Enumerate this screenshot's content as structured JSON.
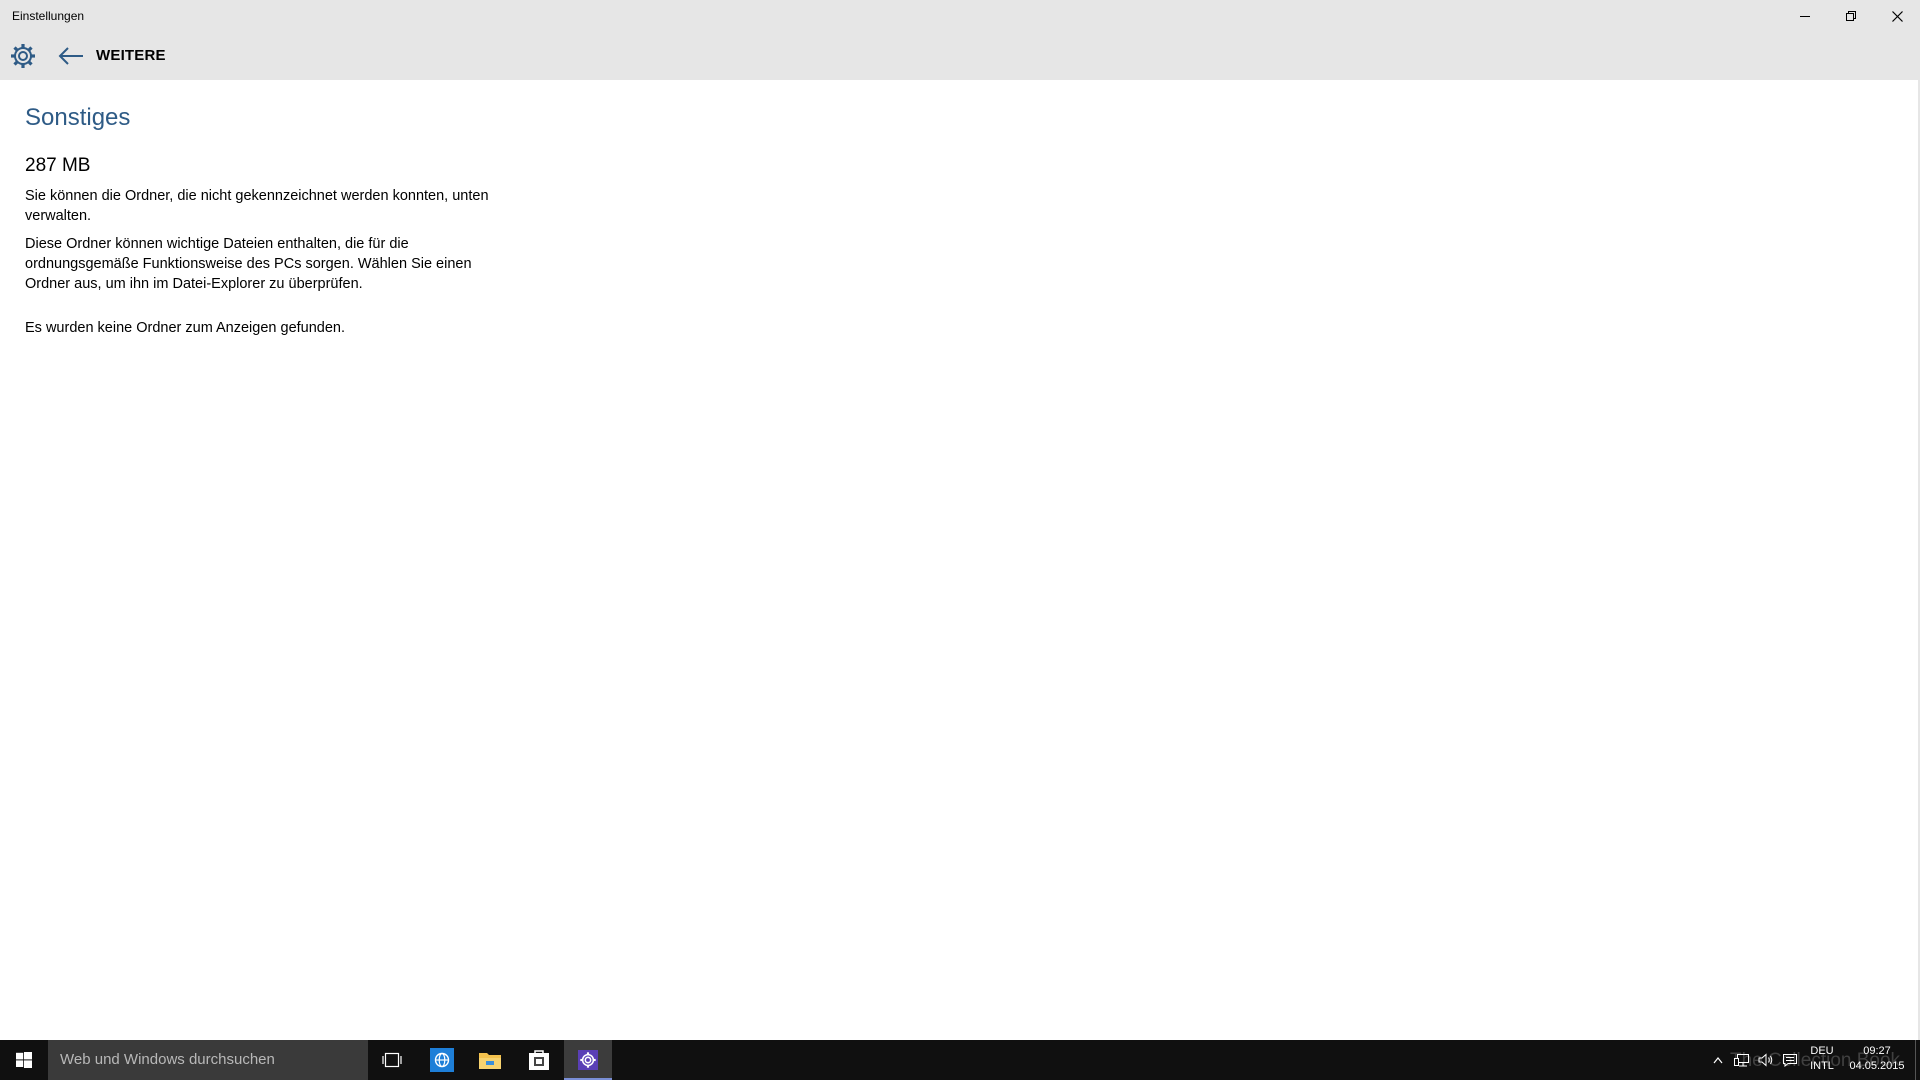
{
  "window": {
    "title": "Einstellungen"
  },
  "header": {
    "section_title": "WEITERE"
  },
  "main": {
    "page_title": "Sonstiges",
    "size": "287 MB",
    "paragraph1": "Sie können die Ordner, die nicht gekennzeichnet werden konnten, unten verwalten.",
    "paragraph2": "Diese Ordner können wichtige Dateien enthalten, die für die ordnungsgemäße Funktionsweise des PCs sorgen. Wählen Sie einen Ordner aus, um ihn im Datei-Explorer zu überprüfen.",
    "paragraph3": "Es wurden keine Ordner zum Anzeigen gefunden."
  },
  "taskbar": {
    "search_placeholder": "Web und Windows durchsuchen",
    "language_line1": "DEU",
    "language_line2": "INTL",
    "time": "09:27",
    "date": "04.05.2015",
    "watermark": "The Collection Book",
    "icons": [
      "windows-start-icon",
      "task-view-icon",
      "internet-explorer-icon",
      "file-explorer-icon",
      "store-icon",
      "settings-icon",
      "tray-up-arrow-icon",
      "network-icon",
      "volume-icon",
      "action-center-icon"
    ]
  },
  "colors": {
    "title_bar": "#e6e6e6",
    "accent_title": "#2e5b86",
    "taskbar": "#101010",
    "search_box": "#3a3a3a"
  }
}
